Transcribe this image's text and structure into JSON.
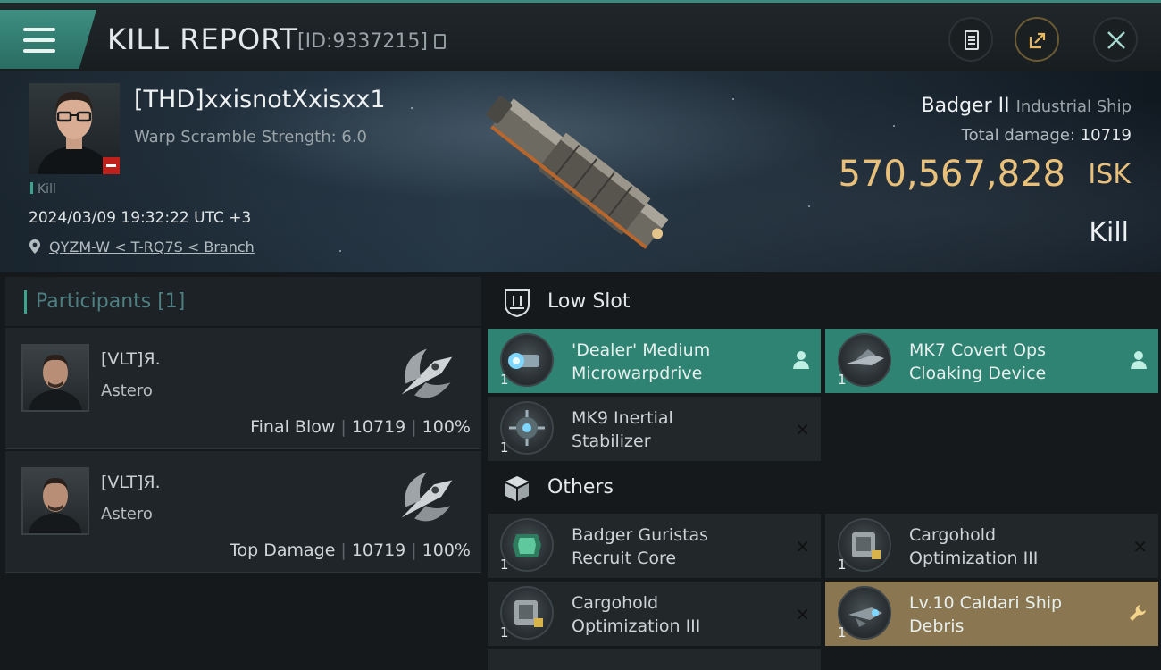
{
  "header": {
    "title": "KILL REPORT",
    "report_id": "[ID:9337215]",
    "accent_color": "#3d8f82"
  },
  "victim": {
    "name": "[THD]xxisnotXxisxx1",
    "warp_scramble": "Warp Scramble Strength: 6.0",
    "tag": "Kill",
    "time": "2024/03/09 19:32:22 UTC +3",
    "location": "QYZM-W < T-RQ7S < Branch",
    "ship_name": "Badger II",
    "ship_class": "Industrial Ship",
    "total_damage_label": "Total damage:",
    "total_damage": "10719",
    "isk_value": "570,567,828",
    "isk_unit": "ISK",
    "result": "Kill",
    "isk_color": "#e8c07a"
  },
  "participants": {
    "title": "Participants [1]",
    "rows": [
      {
        "name": "[VLT]Я.",
        "ship": "Astero",
        "role": "Final Blow",
        "damage": "10719",
        "percent": "100%"
      },
      {
        "name": "[VLT]Я.",
        "ship": "Astero",
        "role": "Top Damage",
        "damage": "10719",
        "percent": "100%"
      }
    ]
  },
  "modules": {
    "low_slot_title": "Low Slot",
    "others_title": "Others",
    "low_slot": [
      {
        "qty": "1",
        "line1": "'Dealer' Medium",
        "line2": "Microwarpdrive",
        "state": "person-icon"
      },
      {
        "qty": "1",
        "line1": "MK7 Covert Ops",
        "line2": "Cloaking Device",
        "state": "person-icon"
      },
      {
        "qty": "1",
        "line1": "MK9 Inertial",
        "line2": "Stabilizer",
        "state": "x-icon",
        "status_glyph": "✕"
      }
    ],
    "others": [
      {
        "qty": "1",
        "line1": "Badger Guristas",
        "line2": "Recruit Core",
        "state": "x-icon",
        "status_glyph": "✕"
      },
      {
        "qty": "1",
        "line1": "Cargohold",
        "line2": "Optimization III",
        "state": "x-icon",
        "status_glyph": "✕"
      },
      {
        "qty": "1",
        "line1": "Cargohold",
        "line2": "Optimization III",
        "state": "x-icon",
        "status_glyph": "✕"
      },
      {
        "qty": "1",
        "line1": "Lv.10 Caldari Ship",
        "line2": "Debris",
        "state": "wrench-icon"
      }
    ]
  }
}
